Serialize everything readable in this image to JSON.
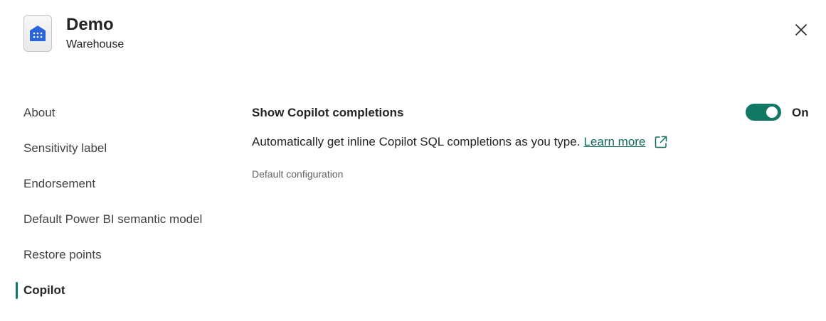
{
  "header": {
    "title": "Demo",
    "subtitle": "Warehouse",
    "icon": "warehouse-icon",
    "close_icon": "close-icon"
  },
  "nav": {
    "items": [
      {
        "label": "About"
      },
      {
        "label": "Sensitivity label"
      },
      {
        "label": "Endorsement"
      },
      {
        "label": "Default Power BI semantic model"
      },
      {
        "label": "Restore points"
      },
      {
        "label": "Copilot"
      }
    ],
    "active": "Copilot"
  },
  "setting": {
    "title": "Show Copilot completions",
    "description": "Automatically get inline Copilot SQL completions as you type.",
    "link_label": "Learn more",
    "link_icon": "external-link-icon",
    "note": "Default configuration",
    "toggle_state": "On"
  },
  "colors": {
    "accent": "#117865",
    "link": "#0f6c5c",
    "icon_blue": "#2b64d8"
  }
}
